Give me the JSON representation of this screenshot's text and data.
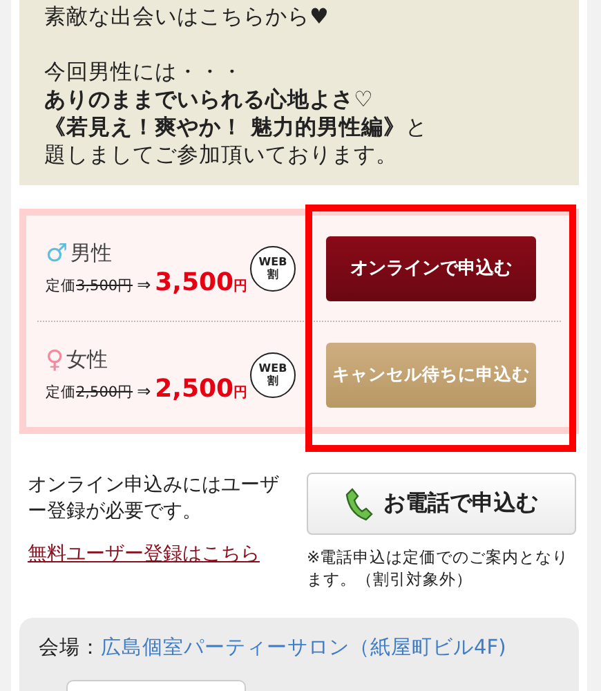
{
  "intro": {
    "paragraphs": [
      [
        "素敵な出会いはこちらから♥"
      ],
      [
        "今回男性には・・・",
        "**ありのままでいられる心地よさ♡**",
        "**《若見え！爽やか！ 魅力的男性編》**と",
        "題しましてご参加頂いております。"
      ]
    ]
  },
  "pricing": [
    {
      "symbol": "♂",
      "color": "#5bc0de",
      "label": "男性",
      "list_label": "定価",
      "list_price": "3,500円",
      "arrow": "⇒",
      "price": "3,500",
      "unit": "円",
      "badge_top": "WEB",
      "badge_bottom": "割",
      "button": {
        "label": "オンラインで申込む",
        "kind": "online"
      }
    },
    {
      "symbol": "♀",
      "color": "#f08aa0",
      "label": "女性",
      "list_label": "定価",
      "list_price": "2,500円",
      "arrow": "⇒",
      "price": "2,500",
      "unit": "円",
      "badge_top": "WEB",
      "badge_bottom": "割",
      "button": {
        "label": "キャンセル待ちに申込む",
        "kind": "waitlist"
      }
    }
  ],
  "registration": {
    "note": "オンライン申込みにはユーザー登録が必要です。",
    "link": "無料ユーザー登録はこちら"
  },
  "phone": {
    "button": "お電話で申込む",
    "note": "※電話申込は定価でのご案内となります。（割引対象外）"
  },
  "venue": {
    "label": "会場：",
    "name": "広島個室パーティーサロン（紙屋町ビル4F)"
  }
}
